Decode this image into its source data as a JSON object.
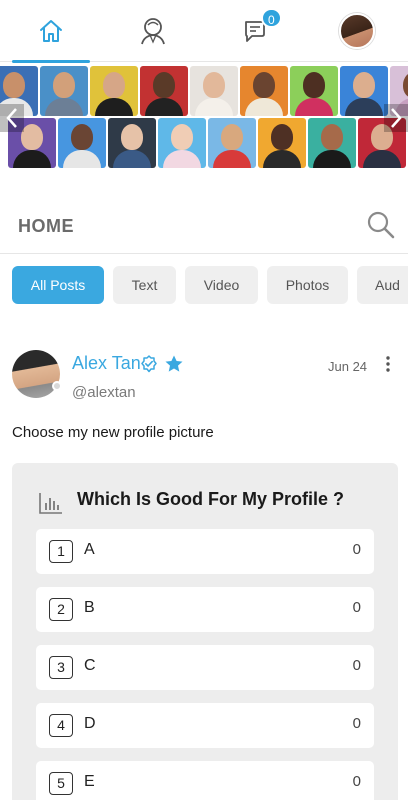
{
  "nav": {
    "items": [
      {
        "name": "home-icon",
        "active": true
      },
      {
        "name": "profile-icon",
        "active": false
      },
      {
        "name": "messages-icon",
        "active": false,
        "badge": "0"
      },
      {
        "name": "avatar",
        "active": false
      }
    ]
  },
  "banner": {
    "prev_icon": "chevron-left-icon",
    "next_icon": "chevron-right-icon"
  },
  "home": {
    "title": "HOME",
    "search_icon": "search-icon"
  },
  "tabs": [
    {
      "label": "All Posts",
      "active": true
    },
    {
      "label": "Text",
      "active": false
    },
    {
      "label": "Video",
      "active": false
    },
    {
      "label": "Photos",
      "active": false
    },
    {
      "label": "Aud",
      "active": false
    }
  ],
  "post": {
    "author": "Alex Tan",
    "handle": "@alextan",
    "date": "Jun 24",
    "text": "Choose my new profile picture",
    "poll": {
      "title": "Which Is Good For My Profile ?",
      "options": [
        {
          "num": "1",
          "label": "A",
          "count": "0"
        },
        {
          "num": "2",
          "label": "B",
          "count": "0"
        },
        {
          "num": "3",
          "label": "C",
          "count": "0"
        },
        {
          "num": "4",
          "label": "D",
          "count": "0"
        },
        {
          "num": "5",
          "label": "E",
          "count": "0"
        }
      ]
    }
  },
  "colors": {
    "accent": "#3aa8e0",
    "tab_bg": "#efefef",
    "poll_bg": "#ededed"
  }
}
